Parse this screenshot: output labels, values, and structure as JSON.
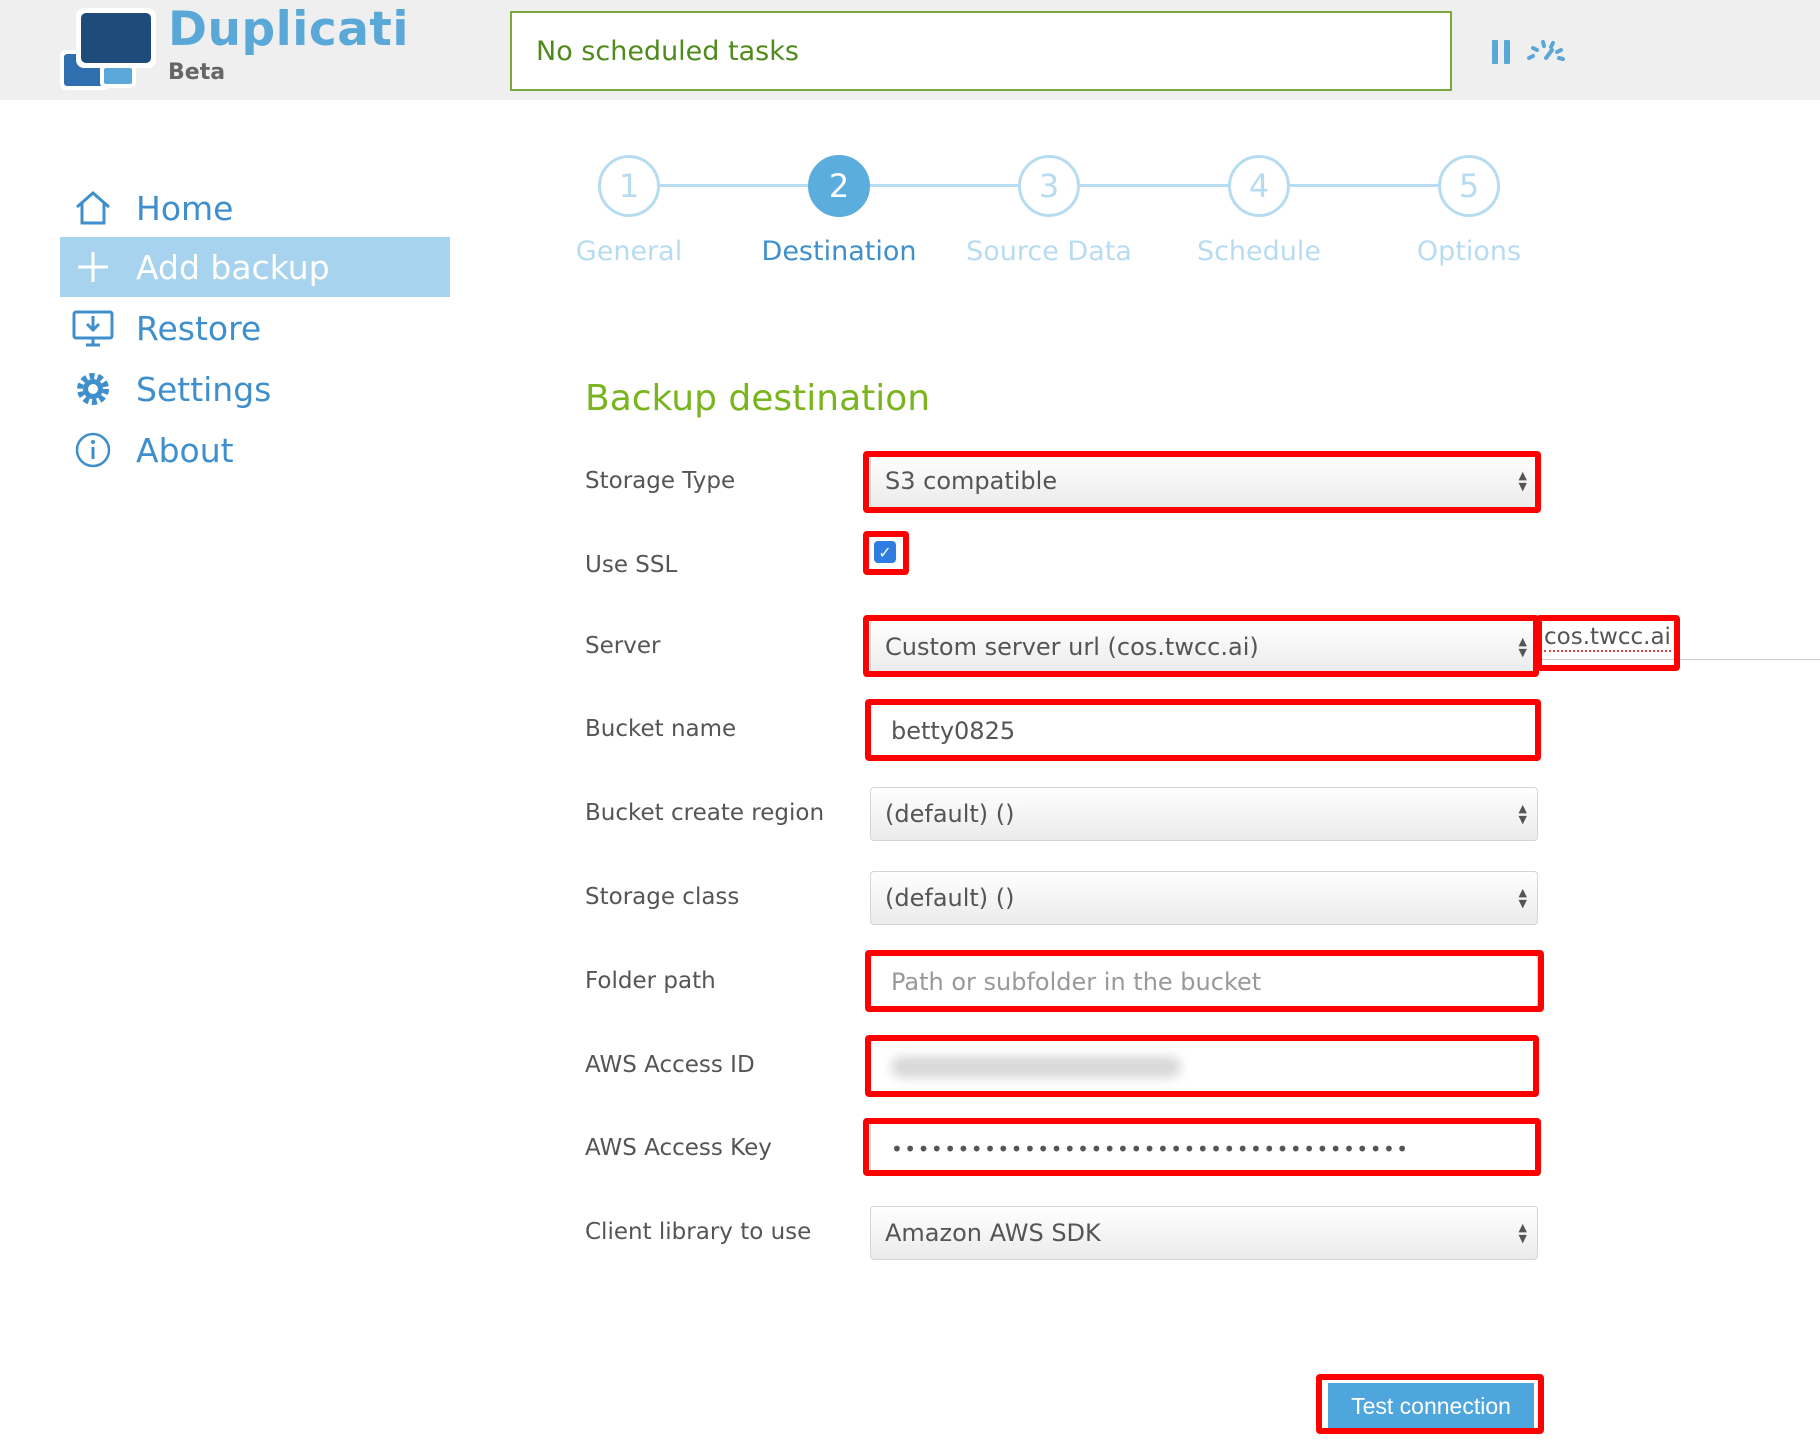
{
  "app": {
    "name": "Duplicati",
    "tag": "Beta",
    "status": "No scheduled tasks"
  },
  "sidebar": {
    "items": [
      {
        "label": "Home",
        "icon": "home-icon"
      },
      {
        "label": "Add backup",
        "icon": "plus-icon",
        "active": true
      },
      {
        "label": "Restore",
        "icon": "restore-icon"
      },
      {
        "label": "Settings",
        "icon": "gear-icon"
      },
      {
        "label": "About",
        "icon": "info-icon"
      }
    ]
  },
  "wizard": {
    "steps": [
      {
        "number": "1",
        "label": "General"
      },
      {
        "number": "2",
        "label": "Destination",
        "active": true
      },
      {
        "number": "3",
        "label": "Source Data"
      },
      {
        "number": "4",
        "label": "Schedule"
      },
      {
        "number": "5",
        "label": "Options"
      }
    ]
  },
  "form": {
    "title": "Backup destination",
    "storage_type": {
      "label": "Storage Type",
      "value": "S3 compatible"
    },
    "use_ssl": {
      "label": "Use SSL",
      "checked": true
    },
    "server": {
      "label": "Server",
      "value": "Custom server url (cos.twcc.ai)",
      "custom_value": "cos.twcc.ai"
    },
    "bucket_name": {
      "label": "Bucket name",
      "value": "betty0825"
    },
    "bucket_region": {
      "label": "Bucket create region",
      "value": "(default) ()"
    },
    "storage_class": {
      "label": "Storage class",
      "value": "(default) ()"
    },
    "folder_path": {
      "label": "Folder path",
      "placeholder": "Path or subfolder in the bucket"
    },
    "access_id": {
      "label": "AWS Access ID"
    },
    "access_key": {
      "label": "AWS Access Key",
      "masked": "•••••••••••••••••••••••••••••••••••••••"
    },
    "client_library": {
      "label": "Client library to use",
      "value": "Amazon AWS SDK"
    },
    "test_button": "Test connection"
  },
  "colors": {
    "brand_blue": "#5aa8d8",
    "nav_blue": "#3f8fcc",
    "active_nav_bg": "#a7d3ee",
    "title_green": "#7ab51d",
    "status_border": "#7ba83c",
    "highlight_red": "#ff0000",
    "button_blue": "#4fa6dc"
  }
}
